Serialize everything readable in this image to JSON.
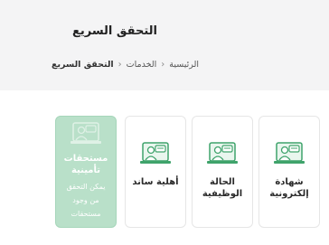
{
  "header": {
    "title": "التحقق السريع",
    "breadcrumb": {
      "home": "الرئيسية",
      "services": "الخدمات",
      "current": "التحقق السريع"
    }
  },
  "cards": [
    {
      "label": "شهادة إلكترونية",
      "icon": "verification-agent-icon"
    },
    {
      "label": "الحالة الوظيفية",
      "icon": "verification-agent-icon"
    },
    {
      "label": "أهلية ساند",
      "icon": "verification-agent-icon"
    },
    {
      "label": "مستحقات تأمينية",
      "icon": "verification-agent-icon",
      "description": "يمكن التحقق من وجود مستحقات",
      "active": true
    }
  ],
  "colors": {
    "accent": "#3fa36b",
    "active_card": "#b9e0c9",
    "header_bg": "#f4f4f5"
  }
}
